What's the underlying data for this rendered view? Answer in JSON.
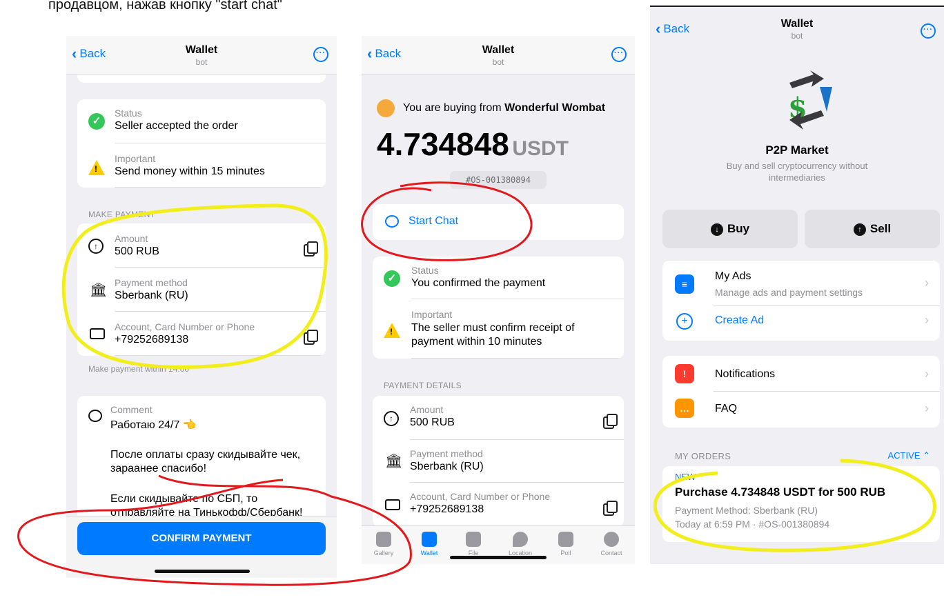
{
  "caption": "продавцом, нажав кнопку \"start chat\"",
  "accent_blue": "#007aff",
  "annotation_colors": {
    "yellow": "#f2ee1e",
    "red": "#e2191c"
  },
  "common": {
    "back": "Back",
    "bot_title": "Wallet",
    "bot_subtitle": "bot"
  },
  "left": {
    "stray_dot": ".",
    "status_label": "Status",
    "status_value": "Seller accepted the order",
    "important_label": "Important",
    "important_value": "Send money within 15 minutes",
    "section": "MAKE PAYMENT",
    "amount_label": "Amount",
    "amount_value": "500 RUB",
    "method_label": "Payment method",
    "method_value": "Sberbank (RU)",
    "account_label": "Account, Card Number or Phone",
    "account_value": "+79252689138",
    "timer": "Make payment within 14:00",
    "comment_label": "Comment",
    "comment_line1": "Работаю 24/7 👈",
    "comment_line2": "После оплаты сразу скидывайте чек, зараанее спасибо!",
    "comment_line3": "Если скидывайте по СБП, то отправляйте на Тинькофф/Сбербанк!",
    "confirm_button": "CONFIRM PAYMENT"
  },
  "middle": {
    "buying_prefix": "You are buying from",
    "seller": "Wonderful Wombat",
    "amount": "4.734848",
    "currency": "USDT",
    "order_id": "#OS-001380894",
    "start_chat": "Start Chat",
    "status_label": "Status",
    "status_value": "You confirmed the payment",
    "important_label": "Important",
    "important_value": "The seller must confirm receipt of payment within 10 minutes",
    "section": "PAYMENT DETAILS",
    "amount_label": "Amount",
    "amount_value": "500 RUB",
    "method_label": "Payment method",
    "method_value": "Sberbank (RU)",
    "account_label": "Account, Card Number or Phone",
    "account_value": "+79252689138",
    "tabs": [
      "Gallery",
      "Wallet",
      "File",
      "Location",
      "Poll",
      "Contact"
    ]
  },
  "right": {
    "market_title": "P2P Market",
    "market_subtitle": "Buy and sell cryptocurrency without intermediaries",
    "buy": "Buy",
    "sell": "Sell",
    "my_ads": "My Ads",
    "my_ads_sub": "Manage ads and payment settings",
    "create_ad": "Create Ad",
    "notifications": "Notifications",
    "faq": "FAQ",
    "orders_header": "MY ORDERS",
    "orders_filter": "ACTIVE",
    "order_badge": "NEW",
    "order_title": "Purchase 4.734848 USDT for 500 RUB",
    "order_method": "Payment Method: Sberbank (RU)",
    "order_time": "Today at 6:59 PM · #OS-001380894"
  }
}
